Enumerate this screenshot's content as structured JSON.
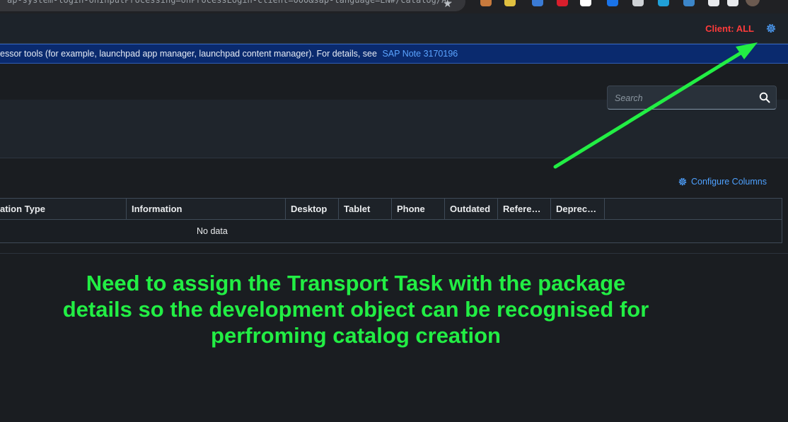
{
  "browser": {
    "url_fragment": "ap-system-login-onInputProcessing=onProcessLogin-client=000&sap-language=EN#/catalog/A…",
    "star": "★"
  },
  "shell": {
    "client_label": "Client: ALL",
    "settings_icon": "gear-icon"
  },
  "banner": {
    "text": "essor tools (for example, launchpad app manager, launchpad content manager). For details, see",
    "link": "SAP Note 3170196"
  },
  "search": {
    "placeholder": "Search",
    "icon": "search-icon"
  },
  "toolbar": {
    "configure_columns": "Configure Columns"
  },
  "table": {
    "columns": [
      "ation Type",
      "Information",
      "Desktop",
      "Tablet",
      "Phone",
      "Outdated",
      "Refere…",
      "Deprec…"
    ],
    "empty_text": "No data"
  },
  "annotation": {
    "line1": "Need to assign the Transport Task with the package",
    "line2": "details so the development object can be recognised for",
    "line3": "perfroming catalog creation",
    "color": "#22ee44"
  },
  "colors": {
    "client": "#ff3b3b",
    "link": "#4ea1ff",
    "banner_bg": "#0a2a6e"
  }
}
